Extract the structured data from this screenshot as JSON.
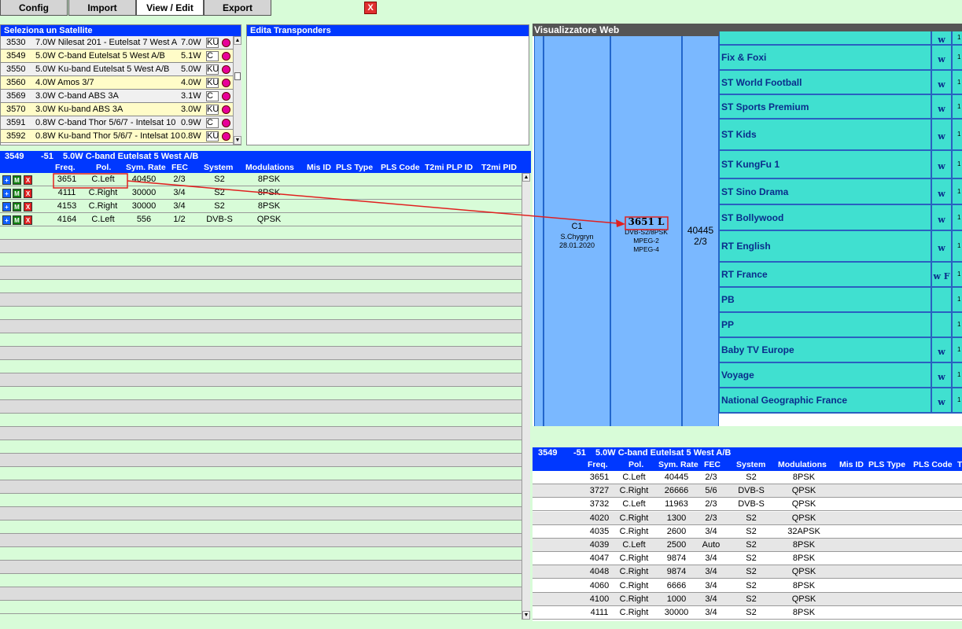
{
  "tabs": [
    {
      "label": "Config",
      "active": false
    },
    {
      "label": "Import",
      "active": false
    },
    {
      "label": "View / Edit",
      "active": true
    },
    {
      "label": "Export",
      "active": false
    }
  ],
  "close_label": "X",
  "satellite_panel": {
    "title": "Seleziona un Satellite",
    "rows": [
      {
        "id": "3530",
        "name": "7.0W Nilesat 201 - Eutelsat 7 West A",
        "pos": "7.0W",
        "band": "KU",
        "highlight": false
      },
      {
        "id": "3549",
        "name": "5.0W C-band Eutelsat 5 West A/B",
        "pos": "5.1W",
        "band": "C",
        "highlight": true
      },
      {
        "id": "3550",
        "name": "5.0W Ku-band Eutelsat 5 West A/B",
        "pos": "5.0W",
        "band": "KU",
        "highlight": false
      },
      {
        "id": "3560",
        "name": "4.0W Amos 3/7",
        "pos": "4.0W",
        "band": "KU",
        "highlight": true
      },
      {
        "id": "3569",
        "name": "3.0W C-band ABS 3A",
        "pos": "3.1W",
        "band": "C",
        "highlight": false
      },
      {
        "id": "3570",
        "name": "3.0W Ku-band ABS 3A",
        "pos": "3.0W",
        "band": "KU",
        "highlight": true
      },
      {
        "id": "3591",
        "name": "0.8W C-band Thor 5/6/7 - Intelsat 10",
        "pos": "0.9W",
        "band": "C",
        "highlight": false
      },
      {
        "id": "3592",
        "name": "0.8W Ku-band Thor 5/6/7 - Intelsat 10",
        "pos": "0.8W",
        "band": "KU",
        "highlight": true
      }
    ]
  },
  "edit_panel": {
    "title": "Edita Transponders"
  },
  "tp_panel": {
    "header": {
      "id": "3549",
      "offset": "-51",
      "name": "5.0W C-band Eutelsat 5 West A/B"
    },
    "columns": [
      "Freq.",
      "Pol.",
      "Sym. Rate",
      "FEC",
      "System",
      "Modulations",
      "Mis ID",
      "PLS Type",
      "PLS Code",
      "T2mi PLP ID",
      "T2mi PID"
    ],
    "button_labels": {
      "plus": "+",
      "m": "M",
      "x": "X"
    },
    "rows": [
      {
        "freq": "3651",
        "pol": "C.Left",
        "sr": "40450",
        "fec": "2/3",
        "sys": "S2",
        "mod": "8PSK"
      },
      {
        "freq": "4111",
        "pol": "C.Right",
        "sr": "30000",
        "fec": "3/4",
        "sys": "S2",
        "mod": "8PSK"
      },
      {
        "freq": "4153",
        "pol": "C.Right",
        "sr": "30000",
        "fec": "3/4",
        "sys": "S2",
        "mod": "8PSK"
      },
      {
        "freq": "4164",
        "pol": "C.Left",
        "sr": "556",
        "fec": "1/2",
        "sys": "DVB-S",
        "mod": "QPSK"
      }
    ]
  },
  "web_viewer": {
    "title": "Visualizzatore Web",
    "cell_c1": {
      "title": "C1",
      "author": "S.Chygryn",
      "date": "28.01.2020"
    },
    "cell_freq": {
      "freq": "3651 L",
      "system": "DVB-S2/8PSK",
      "mpeg2": "MPEG-2",
      "mpeg4": "MPEG-4"
    },
    "cell_sr": {
      "sr": "40445",
      "fec": "2/3"
    },
    "channels": [
      {
        "name": "",
        "tag": "w",
        "tail": "1"
      },
      {
        "name": "Fix & Foxi",
        "tag": "w",
        "tail": "1"
      },
      {
        "name": "ST World Football",
        "tag": "w",
        "tail": "1"
      },
      {
        "name": "ST Sports Premium",
        "tag": "w",
        "tail": "1"
      },
      {
        "name": "ST Kids",
        "tag": "w",
        "tail": "1"
      },
      {
        "name": "ST KungFu 1",
        "tag": "w",
        "tail": "1"
      },
      {
        "name": "ST Sino Drama",
        "tag": "w",
        "tail": "1"
      },
      {
        "name": "ST Bollywood",
        "tag": "w",
        "tail": "1"
      },
      {
        "name": "RT English",
        "tag": "w",
        "tail": "1"
      },
      {
        "name": "RT France",
        "tag": "w F",
        "tail": "1"
      },
      {
        "name": "PB",
        "tag": "",
        "tail": "1"
      },
      {
        "name": "PP",
        "tag": "",
        "tail": "1"
      },
      {
        "name": "Baby TV Europe",
        "tag": "w",
        "tail": "1"
      },
      {
        "name": "Voyage",
        "tag": "w",
        "tail": "1"
      },
      {
        "name": "National Geographic France",
        "tag": "w",
        "tail": "1"
      }
    ]
  },
  "bottom_table": {
    "header": {
      "id": "3549",
      "offset": "-51",
      "name": "5.0W C-band Eutelsat 5 West A/B"
    },
    "columns": [
      "Freq.",
      "Pol.",
      "Sym. Rate",
      "FEC",
      "System",
      "Modulations",
      "Mis ID",
      "PLS Type",
      "PLS Code",
      "T"
    ],
    "rows": [
      {
        "freq": "3651",
        "pol": "C.Left",
        "sr": "40445",
        "fec": "2/3",
        "sys": "S2",
        "mod": "8PSK"
      },
      {
        "freq": "3727",
        "pol": "C.Right",
        "sr": "26666",
        "fec": "5/6",
        "sys": "DVB-S",
        "mod": "QPSK"
      },
      {
        "freq": "3732",
        "pol": "C.Left",
        "sr": "11963",
        "fec": "2/3",
        "sys": "DVB-S",
        "mod": "QPSK"
      },
      {
        "freq": "4020",
        "pol": "C.Right",
        "sr": "1300",
        "fec": "2/3",
        "sys": "S2",
        "mod": "QPSK"
      },
      {
        "freq": "4035",
        "pol": "C.Right",
        "sr": "2600",
        "fec": "3/4",
        "sys": "S2",
        "mod": "32APSK"
      },
      {
        "freq": "4039",
        "pol": "C.Left",
        "sr": "2500",
        "fec": "Auto",
        "sys": "S2",
        "mod": "8PSK"
      },
      {
        "freq": "4047",
        "pol": "C.Right",
        "sr": "9874",
        "fec": "3/4",
        "sys": "S2",
        "mod": "8PSK"
      },
      {
        "freq": "4048",
        "pol": "C.Right",
        "sr": "9874",
        "fec": "3/4",
        "sys": "S2",
        "mod": "QPSK"
      },
      {
        "freq": "4060",
        "pol": "C.Right",
        "sr": "6666",
        "fec": "3/4",
        "sys": "S2",
        "mod": "8PSK"
      },
      {
        "freq": "4100",
        "pol": "C.Right",
        "sr": "1000",
        "fec": "3/4",
        "sys": "S2",
        "mod": "QPSK"
      },
      {
        "freq": "4111",
        "pol": "C.Right",
        "sr": "30000",
        "fec": "3/4",
        "sys": "S2",
        "mod": "8PSK"
      }
    ]
  },
  "colors": {
    "header_blue": "#0038ff",
    "accent_red": "#e02020",
    "row_yellow": "#fffcc8",
    "channel_teal": "#40e0d0",
    "cell_blue": "#7ab8ff",
    "bg_green": "#d8fcd8"
  }
}
